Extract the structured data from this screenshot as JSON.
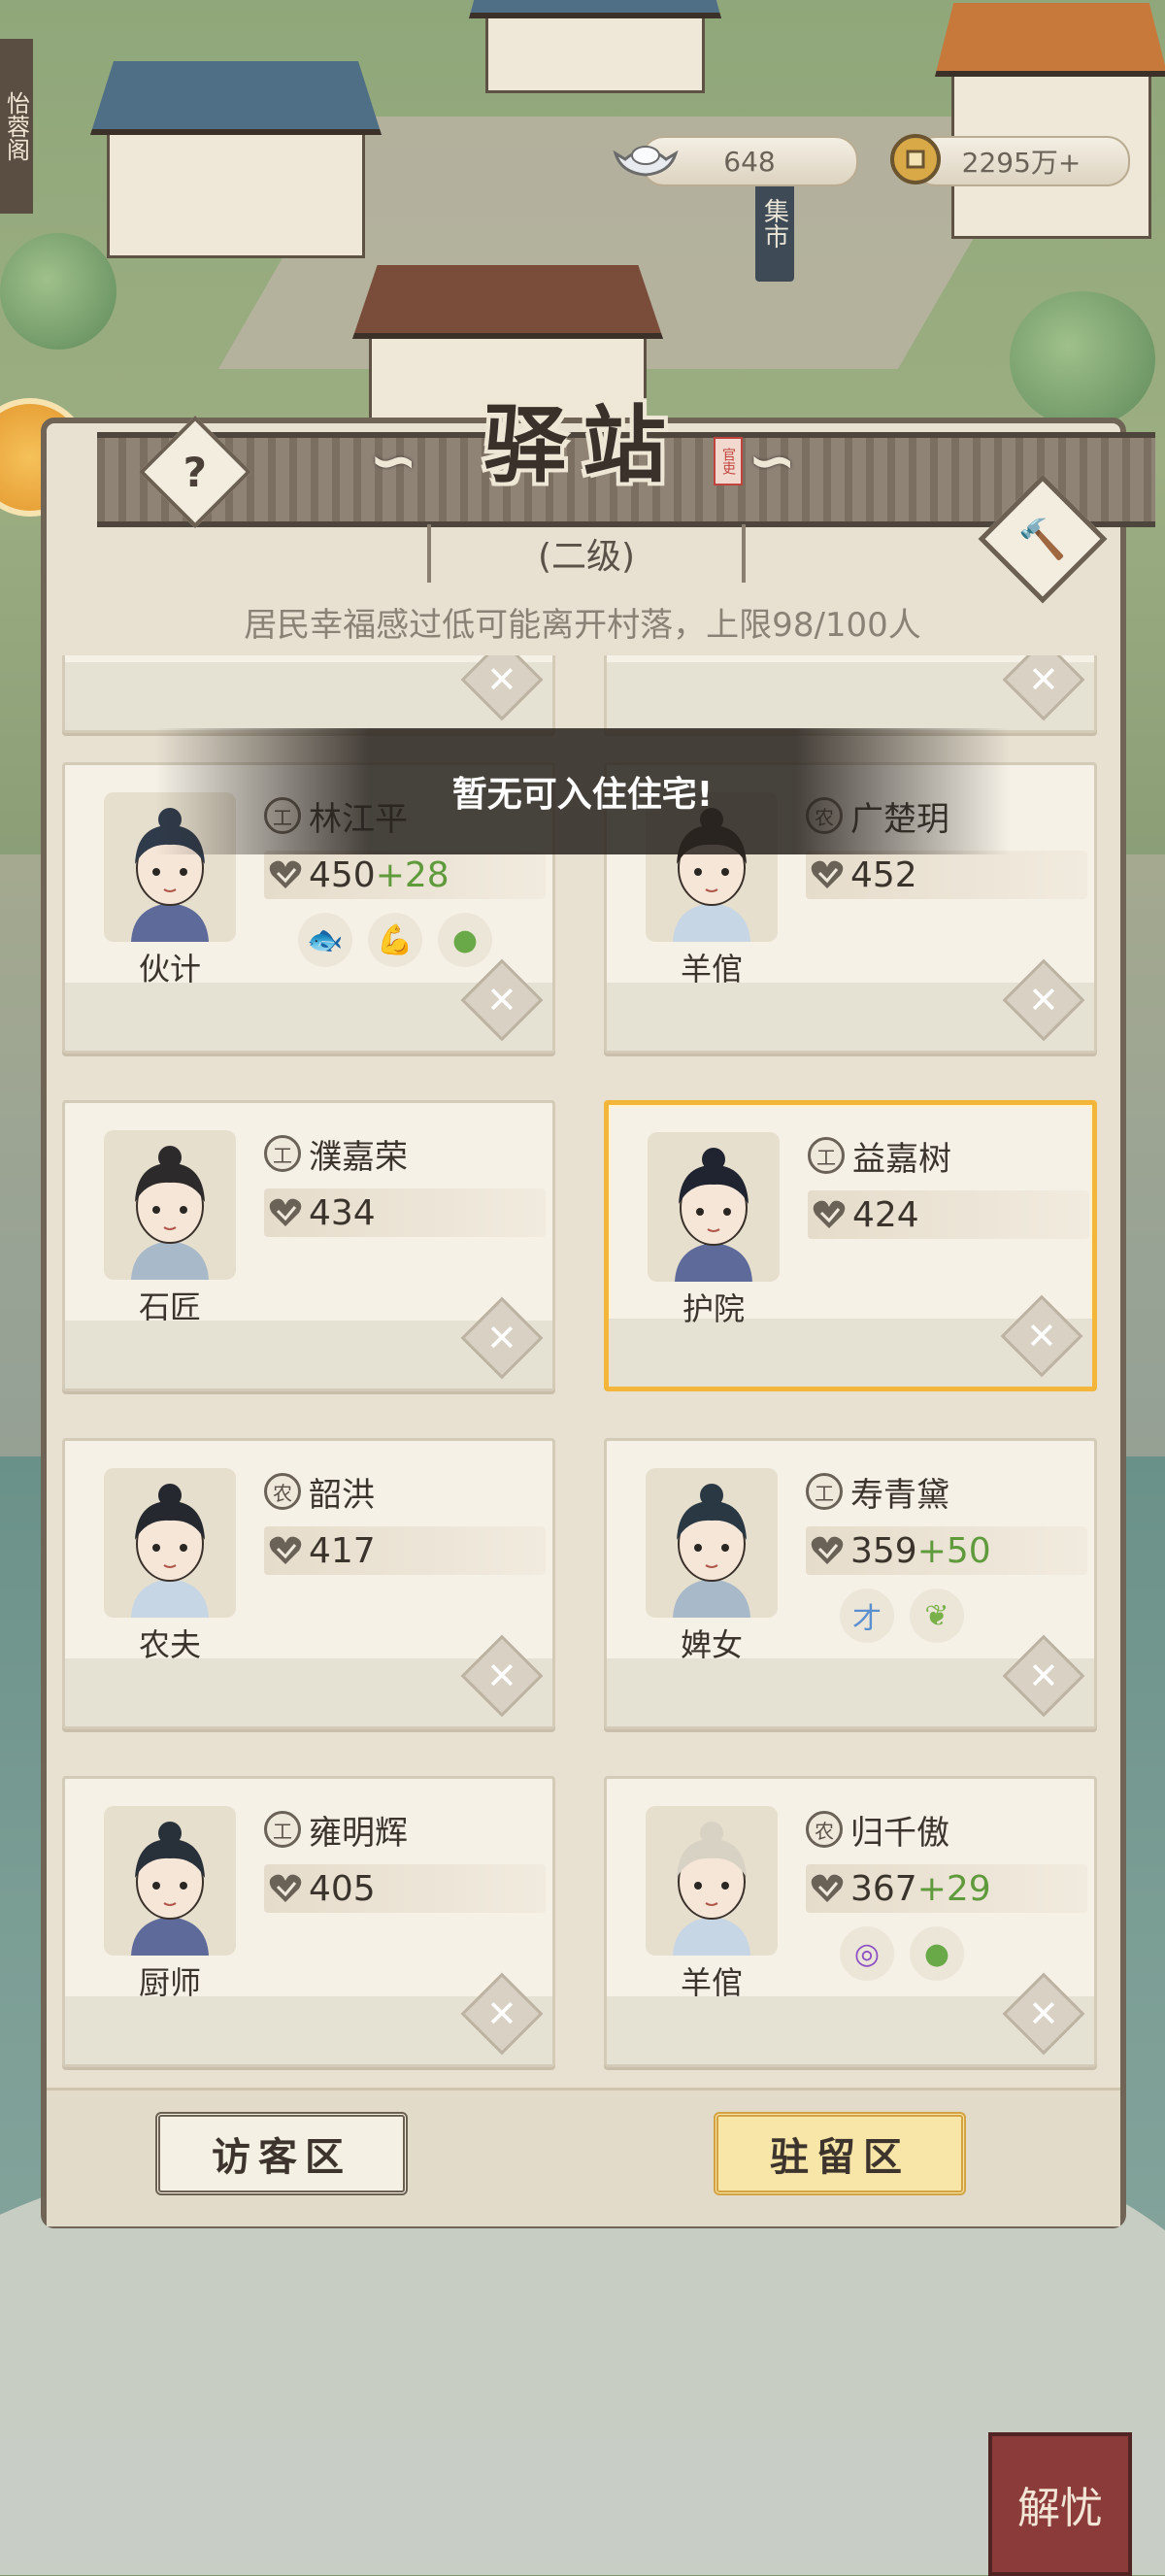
{
  "header": {
    "title": "驿站",
    "seal_text": "官吏",
    "level": "(二级)",
    "notice": "居民幸福感过低可能离开村落，上限98/100人",
    "help_label": "?"
  },
  "scene": {
    "market_sign": "集市",
    "left_sign": "怡蓉阁"
  },
  "currency": {
    "silver": "648",
    "coins": "2295万+"
  },
  "toast": "暂无可入住住宅!",
  "residents": [
    {
      "badge": "工",
      "name": "林江平",
      "role": "伙计",
      "stat": "450",
      "bonus": "+28",
      "traits": [
        "fish-icon",
        "muscle-icon",
        "body-icon"
      ]
    },
    {
      "badge": "农",
      "name": "广楚玥",
      "role": "羊倌",
      "stat": "452",
      "bonus": "",
      "traits": []
    },
    {
      "badge": "工",
      "name": "濮嘉荣",
      "role": "石匠",
      "stat": "434",
      "bonus": "",
      "traits": []
    },
    {
      "badge": "工",
      "name": "益嘉树",
      "role": "护院",
      "stat": "424",
      "bonus": "",
      "traits": []
    },
    {
      "badge": "农",
      "name": "韶洪",
      "role": "农夫",
      "stat": "417",
      "bonus": "",
      "traits": []
    },
    {
      "badge": "工",
      "name": "寿青黛",
      "role": "婢女",
      "stat": "359",
      "bonus": "+50",
      "traits": [
        "talent-icon",
        "leaf-icon"
      ]
    },
    {
      "badge": "工",
      "name": "雍明辉",
      "role": "厨师",
      "stat": "405",
      "bonus": "",
      "traits": []
    },
    {
      "badge": "农",
      "name": "归千傲",
      "role": "羊倌",
      "stat": "367",
      "bonus": "+29",
      "traits": [
        "purple-swirl-icon",
        "body-icon"
      ]
    }
  ],
  "tabs": {
    "visitor": "访客区",
    "stay": "驻留区"
  },
  "corner_seal": "解忧",
  "colors": {
    "selected_border": "#f3b63a",
    "bonus_green": "#5f9a3c",
    "panel_bg": "#e8e1d2"
  }
}
